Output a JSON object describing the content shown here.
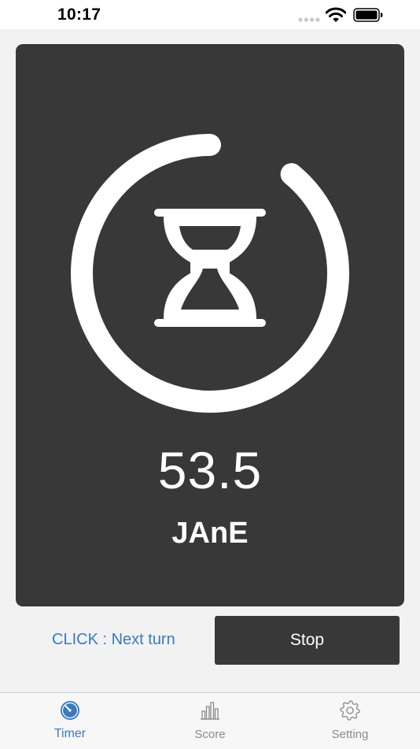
{
  "status_bar": {
    "time": "10:17"
  },
  "timer": {
    "value": "53.5",
    "player": "JAnE",
    "progress_fraction": 0.89
  },
  "actions": {
    "next_turn_label": "CLICK : Next turn",
    "stop_label": "Stop"
  },
  "tab_bar": {
    "tabs": [
      {
        "label": "Timer",
        "icon": "stopwatch-icon",
        "active": true
      },
      {
        "label": "Score",
        "icon": "bar-chart-icon",
        "active": false
      },
      {
        "label": "Setting",
        "icon": "gear-icon",
        "active": false
      }
    ]
  },
  "colors": {
    "accent": "#3a7bbf",
    "card": "#383838",
    "background": "#f2f2f2"
  }
}
